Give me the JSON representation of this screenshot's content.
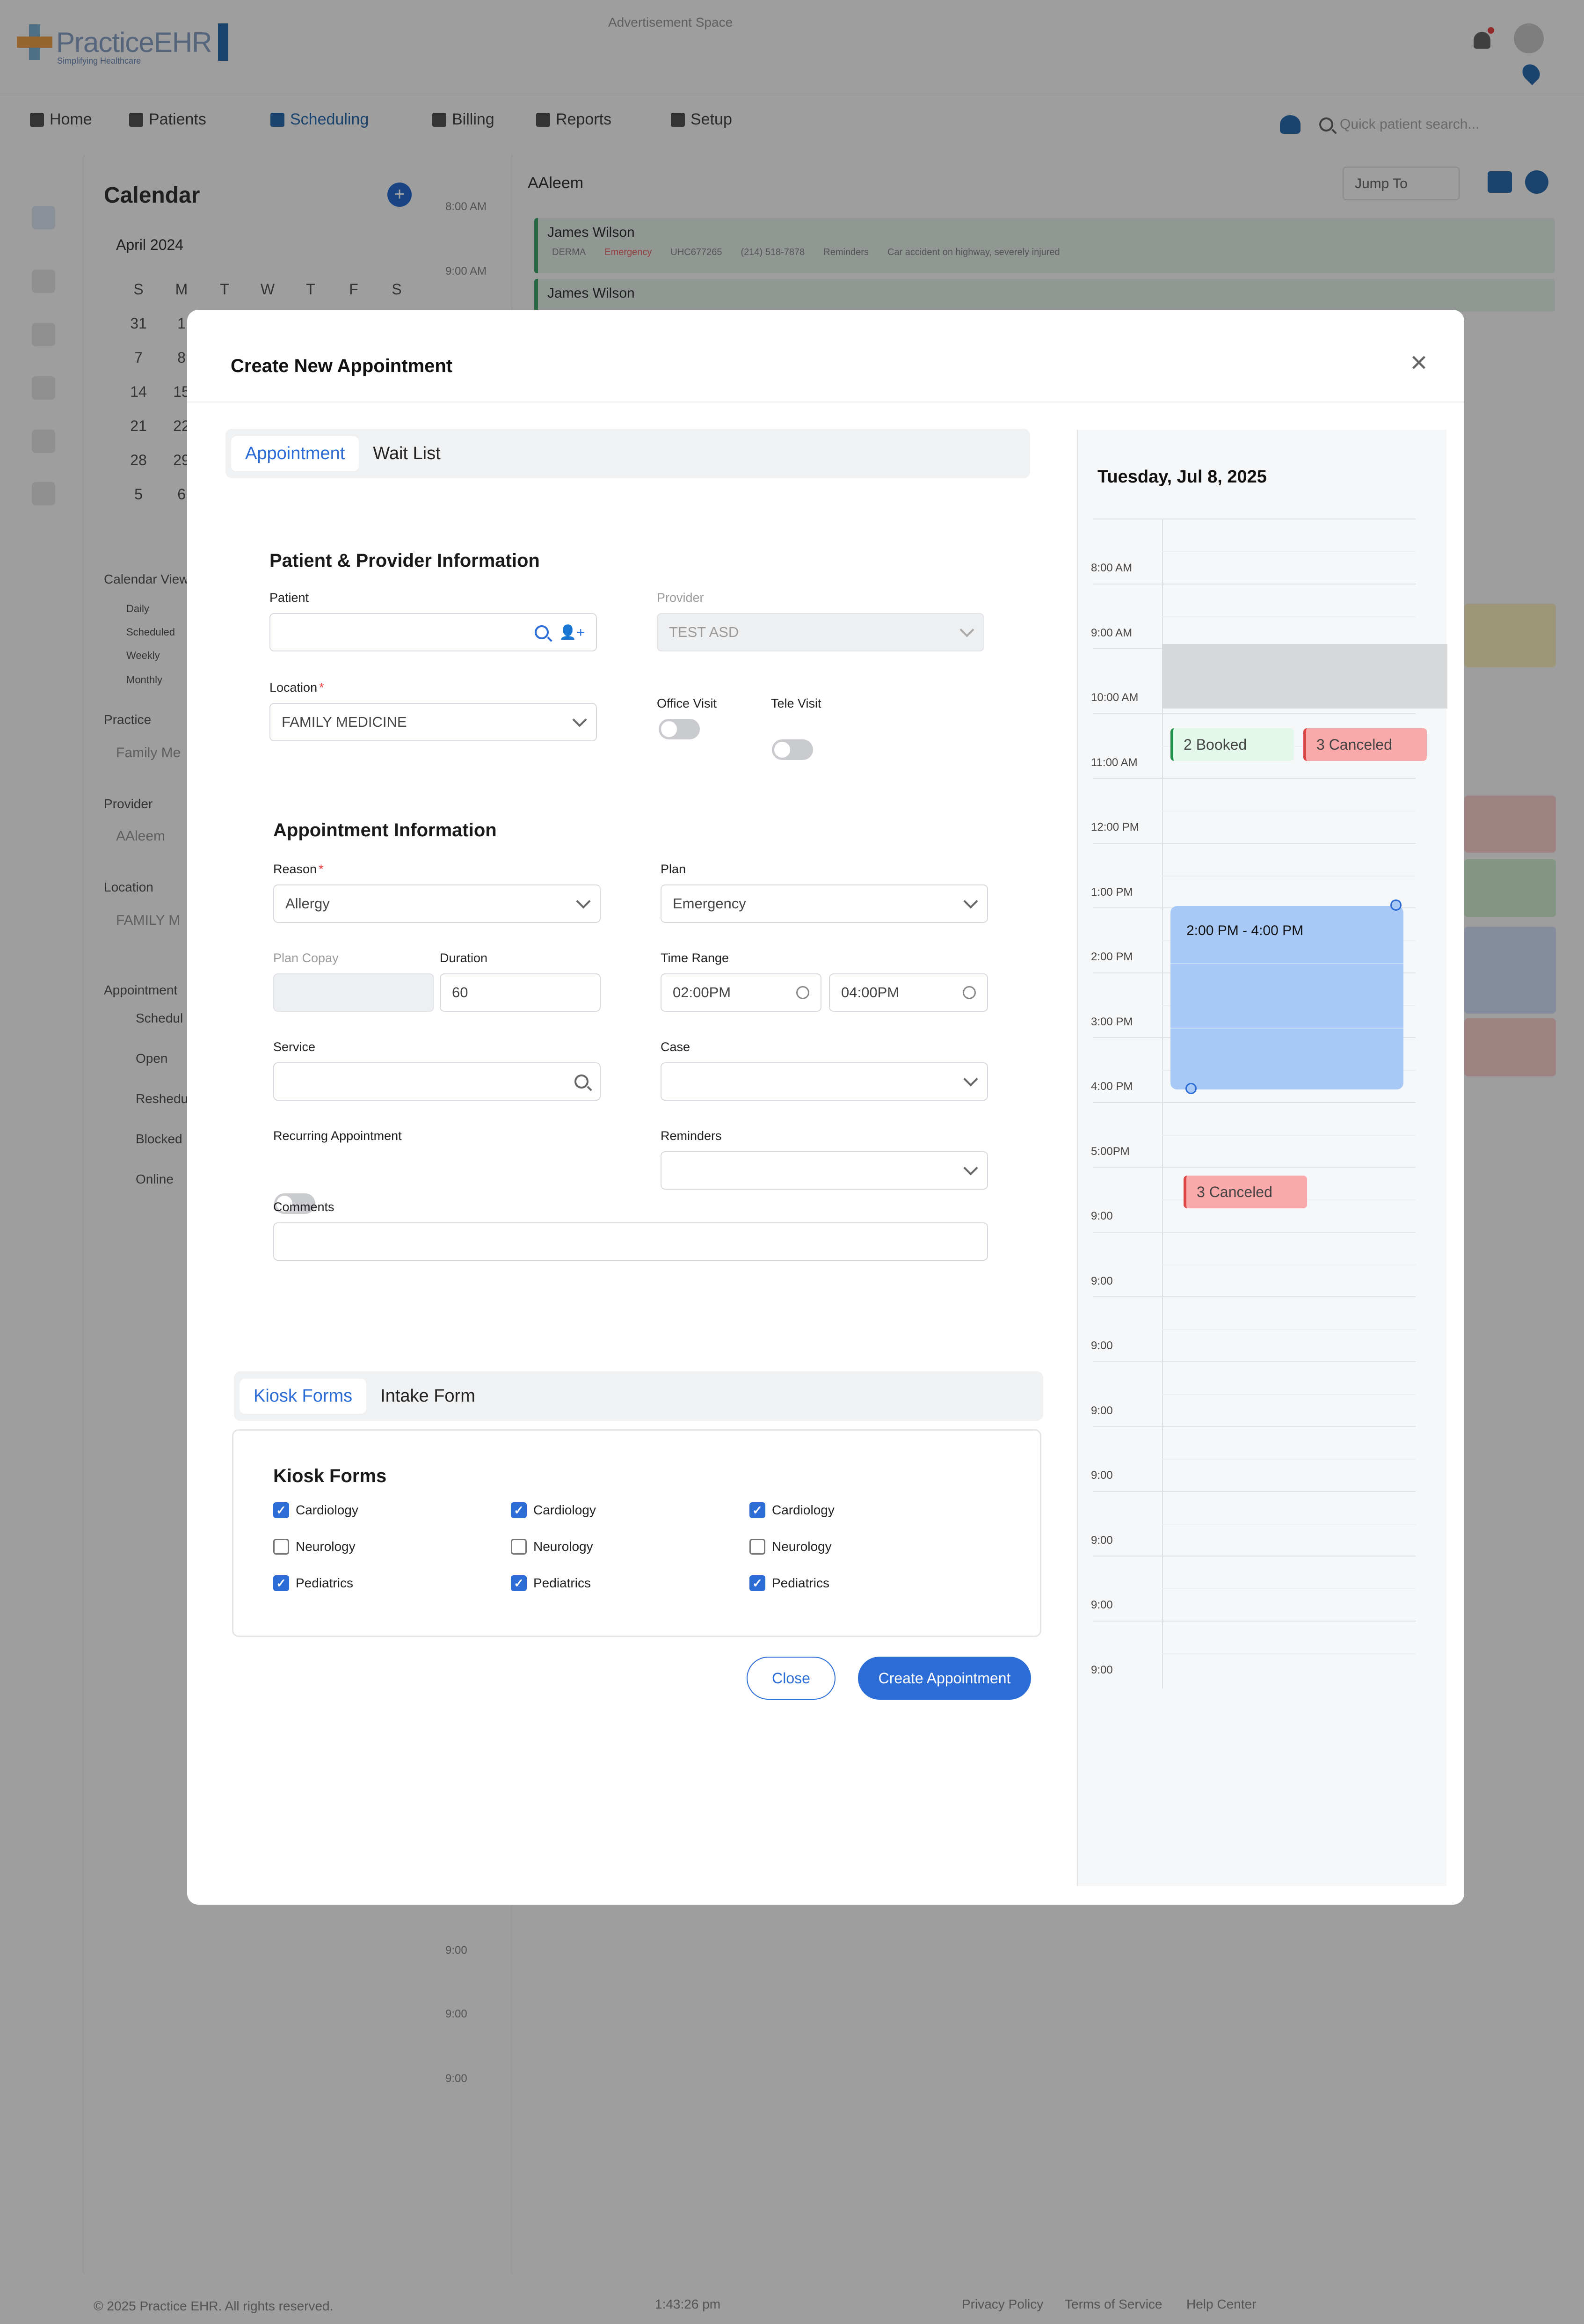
{
  "app": {
    "logo_text": "PracticeEHR",
    "logo_tagline": "Simplifying Healthcare",
    "ad_text": "Advertisement Space",
    "nav": [
      {
        "label": "Home",
        "icon": "home-icon"
      },
      {
        "label": "Patients",
        "icon": "patients-icon"
      },
      {
        "label": "Scheduling",
        "icon": "calendar-icon"
      },
      {
        "label": "Billing",
        "icon": "billing-icon"
      },
      {
        "label": "Reports",
        "icon": "reports-icon"
      },
      {
        "label": "Setup",
        "icon": "gear-icon"
      }
    ],
    "active_nav": "Scheduling",
    "quick_search_placeholder": "Quick patient search...",
    "calendar": {
      "title": "Calendar",
      "month": "April 2024",
      "weekdays": [
        "S",
        "M",
        "T",
        "W",
        "T",
        "F",
        "S"
      ],
      "days": [
        "31",
        "1",
        "",
        "",
        "",
        "",
        "",
        "7",
        "8",
        "",
        "",
        "",
        "",
        "",
        "14",
        "15",
        "",
        "",
        "",
        "",
        "",
        "21",
        "22",
        "",
        "",
        "",
        "",
        "",
        "28",
        "29",
        "",
        "",
        "",
        "",
        "",
        "5",
        "6",
        "",
        "",
        "",
        "",
        ""
      ],
      "calendar_view_label": "Calendar View",
      "views": [
        "Daily",
        "Scheduled",
        "Weekly",
        "Monthly"
      ],
      "practice_label": "Practice",
      "practice_value": "Family Me",
      "provider_label": "Provider",
      "provider_value": "AAleem",
      "location_label": "Location",
      "location_value": "FAMILY M",
      "appointment_label": "Appointment",
      "statuses": [
        "Schedul",
        "Open",
        "Reshedu",
        "Blocked",
        "Online"
      ]
    },
    "schedule": {
      "provider": "AAleem",
      "jump_to": "Jump To",
      "times": [
        "8:00 AM",
        "9:00 AM",
        "9:00",
        "9:00",
        "9:00"
      ],
      "events": [
        {
          "name": "James Wilson",
          "details": [
            "DERMA",
            "Emergency",
            "UHC677265",
            "(214) 518-7878",
            "Reminders",
            "Car accident on highway, severely injured"
          ]
        },
        {
          "name": "James Wilson"
        }
      ]
    },
    "footer": {
      "copyright": "© 2025 Practice EHR. All rights reserved.",
      "clock": "1:43:26 pm",
      "links": [
        "Privacy Policy",
        "Terms of Service",
        "Help Center"
      ]
    }
  },
  "modal": {
    "title": "Create New Appointment",
    "tabs": [
      "Appointment",
      "Wait List"
    ],
    "active_tab": "Appointment",
    "patient_provider": {
      "title": "Patient & Provider Information",
      "patient_label": "Patient",
      "patient_value": "",
      "provider_label": "Provider",
      "provider_value": "TEST ASD",
      "location_label": "Location",
      "location_value": "FAMILY MEDICINE",
      "office_visit_label": "Office Visit",
      "tele_visit_label": "Tele Visit",
      "office_visit_on": false,
      "tele_visit_on": false
    },
    "appointment_info": {
      "title": "Appointment Information",
      "reason_label": "Reason",
      "reason_value": "Allergy",
      "plan_label": "Plan",
      "plan_value": "Emergency",
      "plan_copay_label": "Plan Copay",
      "plan_copay_value": "",
      "duration_label": "Duration",
      "duration_value": "60",
      "time_range_label": "Time Range",
      "time_start": "02:00PM",
      "time_end": "04:00PM",
      "service_label": "Service",
      "service_value": "",
      "case_label": "Case",
      "case_value": "",
      "recurring_label": "Recurring Appointment",
      "recurring_on": false,
      "reminders_label": "Reminders",
      "reminders_value": "",
      "comments_label": "Comments",
      "comments_value": ""
    },
    "forms_tabs": [
      "Kiosk Forms",
      "Intake Form"
    ],
    "forms_active_tab": "Kiosk Forms",
    "kiosk": {
      "title": "Kiosk Forms",
      "columns": [
        [
          {
            "label": "Cardiology",
            "checked": true
          },
          {
            "label": "Neurology",
            "checked": false
          },
          {
            "label": "Pediatrics",
            "checked": true
          }
        ],
        [
          {
            "label": "Cardiology",
            "checked": true
          },
          {
            "label": "Neurology",
            "checked": false
          },
          {
            "label": "Pediatrics",
            "checked": true
          }
        ],
        [
          {
            "label": "Cardiology",
            "checked": true
          },
          {
            "label": "Neurology",
            "checked": false
          },
          {
            "label": "Pediatrics",
            "checked": true
          }
        ]
      ]
    },
    "buttons": {
      "close": "Close",
      "create": "Create Appointment"
    },
    "day_view": {
      "date": "Tuesday, Jul 8, 2025",
      "time_labels": [
        "8:00 AM",
        "9:00 AM",
        "10:00 AM",
        "11:00 AM",
        "12:00 PM",
        "1:00 PM",
        "2:00 PM",
        "3:00 PM",
        "4:00 PM",
        "5:00PM",
        "9:00",
        "9:00",
        "9:00",
        "9:00",
        "9:00",
        "9:00",
        "9:00",
        "9:00"
      ],
      "booked_chip": "2 Booked",
      "canceled_chip": "3 Canceled",
      "canceled_chip_2": "3 Canceled",
      "selection_label": "2:00 PM - 4:00 PM",
      "colors": {
        "booked_bg": "#e3f7ea",
        "booked_border": "#1f8f4a",
        "canceled_bg": "#f9a9a9",
        "canceled_border": "#e04545",
        "selection": "#a8c8f6",
        "accent": "#2b6cd6"
      }
    }
  }
}
